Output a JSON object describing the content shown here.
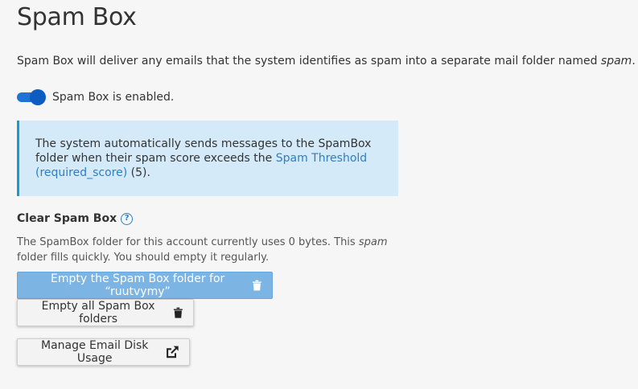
{
  "page": {
    "title": "Spam Box"
  },
  "description": {
    "text": "Spam Box will deliver any emails that the system identifies as spam into a separate mail folder named ",
    "folder_name": "spam",
    "end": "."
  },
  "toggle": {
    "enabled": true,
    "label": "Spam Box is enabled.",
    "accent": "#1d74d8"
  },
  "alert": {
    "text_before": "The system automatically sends messages to the SpamBox folder when their spam score exceeds the ",
    "link_text": "Spam Threshold (required_score)",
    "text_after": " (5)."
  },
  "clear": {
    "title": "Clear Spam Box",
    "usage_before": "The SpamBox folder for this account currently uses 0 bytes. This ",
    "usage_em": "spam",
    "usage_after": " folder fills quickly. You should empty it regularly.",
    "empty_account_label": "Empty the Spam Box folder for “ruutvymy”",
    "empty_all_label": "Empty all Spam Box folders",
    "manage_label": "Manage Email Disk Usage"
  },
  "icons": {
    "help": "question-circle-icon",
    "trash": "trash-icon",
    "external": "external-link-icon"
  }
}
